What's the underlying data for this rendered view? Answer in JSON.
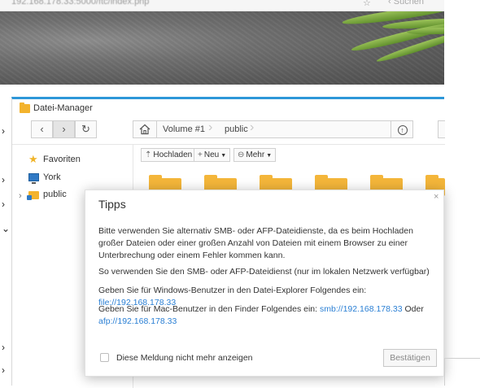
{
  "browser": {
    "url": "192.168.178.33:5000/ftc/index.php",
    "sidebar_search": "Suchen"
  },
  "file_manager": {
    "title": "Datei-Manager",
    "nav": {
      "back": "‹",
      "forward": "›",
      "refresh": "↻"
    },
    "path": {
      "home_icon": "home-icon",
      "crumb1": "Volume #1",
      "crumb2": "public"
    },
    "sidebar": [
      {
        "label": "Favoriten",
        "icon": "star-icon"
      },
      {
        "label": "York",
        "icon": "computer-icon"
      },
      {
        "label": "public",
        "icon": "shared-folder-icon"
      }
    ],
    "toolbar": {
      "upload": "Hochladen",
      "new": "Neu",
      "more": "Mehr"
    }
  },
  "dialog": {
    "title": "Tipps",
    "close": "×",
    "para1": "Bitte verwenden Sie alternativ SMB- oder AFP-Dateidienste, da es beim Hochladen großer Dateien oder einer großen Anzahl von Dateien mit einem Browser zu einer Unterbrechung oder einem Fehler kommen kann.",
    "para2": "So verwenden Sie den SMB- oder AFP-Dateidienst (nur im lokalen Netzwerk verfügbar)",
    "para3_prefix": "Geben Sie für Windows-Benutzer in den Datei-Explorer Folgendes ein: ",
    "para3_link": "file://192.168.178.33",
    "para4_prefix": "Geben Sie für Mac-Benutzer in den Finder Folgendes ein: ",
    "para4_link1": "smb://192.168.178.33",
    "para4_mid": " Oder ",
    "para4_link2": "afp://192.168.178.33",
    "checkbox_label": "Diese Meldung nicht mehr anzeigen",
    "confirm": "Bestätigen"
  },
  "colors": {
    "accent": "#2d97d8",
    "link": "#2a7fd4",
    "folder": "#f4b63a"
  }
}
